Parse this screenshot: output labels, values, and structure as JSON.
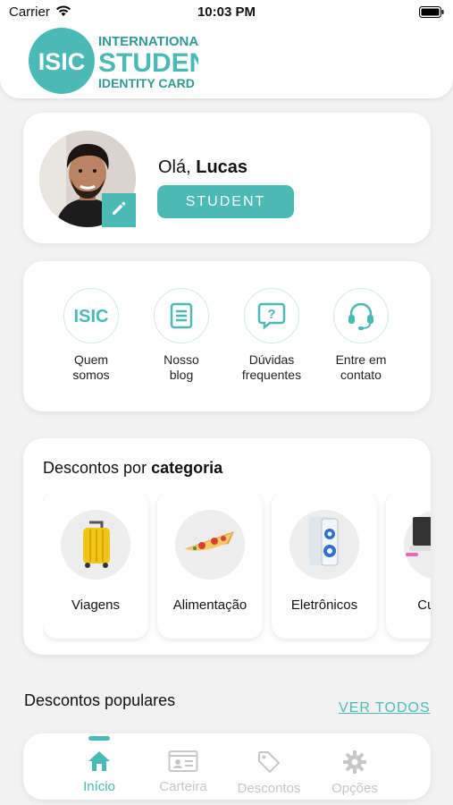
{
  "status_bar": {
    "carrier": "Carrier",
    "time": "10:03 PM"
  },
  "header": {
    "logo_lines": [
      "INTERNATIONAL",
      "STUDENT",
      "IDENTITY CARD"
    ],
    "logo_badge": "ISIC"
  },
  "profile": {
    "greeting_prefix": "Olá, ",
    "user_name": "Lucas",
    "status_label": "STUDENT"
  },
  "quick_links": [
    {
      "line1": "Quem",
      "line2": "somos",
      "icon": "isic-logo-icon"
    },
    {
      "line1": "Nosso",
      "line2": "blog",
      "icon": "document-icon"
    },
    {
      "line1": "Dúvidas",
      "line2": "frequentes",
      "icon": "help-bubble-icon"
    },
    {
      "line1": "Entre em",
      "line2": "contato",
      "icon": "headset-icon"
    }
  ],
  "categories": {
    "title_prefix": "Descontos por ",
    "title_bold": "categoria",
    "items": [
      {
        "label": "Viagens",
        "icon": "suitcase-icon"
      },
      {
        "label": "Alimentação",
        "icon": "pizza-icon"
      },
      {
        "label": "Eletrônicos",
        "icon": "speaker-icon"
      },
      {
        "label": "Cursos",
        "icon": "laptop-icon"
      }
    ]
  },
  "popular": {
    "title": "Descontos populares",
    "see_all": "VER TODOS"
  },
  "tab_bar": {
    "tabs": [
      {
        "label": "Início",
        "icon": "home-icon",
        "active": true
      },
      {
        "label": "Carteira",
        "icon": "id-card-icon",
        "active": false
      },
      {
        "label": "Descontos",
        "icon": "tag-icon",
        "active": false
      },
      {
        "label": "Opções",
        "icon": "gear-icon",
        "active": false
      }
    ]
  },
  "colors": {
    "accent": "#4bbab5",
    "background": "#f2f2f2",
    "inactive_tab": "#c7c7c7"
  }
}
